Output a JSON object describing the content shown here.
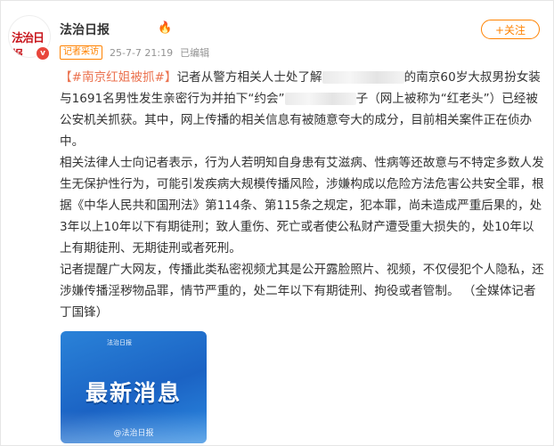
{
  "header": {
    "avatar_text": "法治日报",
    "account_name": "法治日报",
    "verified_mark": "v",
    "tag": "记者采访",
    "timestamp": "25-7-7 21:19",
    "status": "已编辑",
    "follow_label": "+关注"
  },
  "post": {
    "hashtag": "【#南京红姐被抓#】",
    "p1_a": "记者从警方相关人士处了解",
    "p1_b": "的南京60岁大叔男扮女装与1691名男性发生亲密行为并拍下“约会”",
    "p1_c": "子（网上被称为“红老头”）已经被公安机关抓获。其中，网上传播的相关信息有被随意夸大的成分，目前相关案件正在侦办中。",
    "p2": "相关法律人士向记者表示，行为人若明知自身患有艾滋病、性病等还故意与不特定多数人发生无保护性行为，可能引发疾病大规模传播风险，涉嫌构成以危险方法危害公共安全罪，根据《中华人民共和国刑法》第114条、第115条之规定，犯本罪，尚未造成严重后果的，处3年以上10年以下有期徒刑；致人重伤、死亡或者使公私财产遭受重大损失的，处10年以上有期徒刑、无期徒刑或者死刑。",
    "p3": "记者提醒广大网友，传播此类私密视频尤其是公开露脸照片、视频，不仅侵犯个人隐私，还涉嫌传播淫秽物品罪，情节严重的，处二年以下有期徒刑、拘役或者管制。 （全媒体记者 丁国锋）"
  },
  "media": {
    "logo_text": "法治日报",
    "title": "最新消息",
    "watermark": "@法治日报"
  },
  "colors": {
    "accent": "#ff8200",
    "hashtag": "#eb7350",
    "thumb": "#1b63c4"
  }
}
